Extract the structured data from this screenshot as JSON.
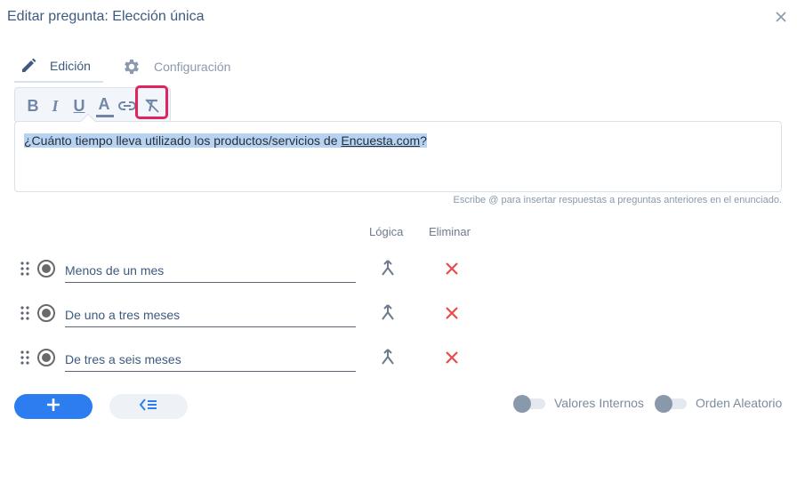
{
  "dialog": {
    "title": "Editar pregunta: Elección única",
    "close_icon": "close-icon"
  },
  "tabs": [
    {
      "label": "Edición",
      "icon": "pencil-icon",
      "active": true
    },
    {
      "label": "Configuración",
      "icon": "gear-icon",
      "active": false
    }
  ],
  "toolbar": {
    "bold": "B",
    "italic": "I",
    "underline": "U",
    "color": "A",
    "link_icon": "link-icon",
    "clear_format_icon": "clear-format-icon",
    "highlight_color": "#e0245e"
  },
  "editor": {
    "text_before": "¿Cuánto tiempo lleva utilizado los productos/servicios de ",
    "link_text": "Encuesta.com",
    "text_after": "?",
    "hint": "Escribe @ para insertar respuestas a preguntas anteriores en el enunciado."
  },
  "columns": {
    "logic": "Lógica",
    "delete": "Eliminar"
  },
  "answers": [
    {
      "value": "Menos de un mes"
    },
    {
      "value": "De uno a tres meses"
    },
    {
      "value": "De tres a seis meses"
    }
  ],
  "footer": {
    "add_icon": "plus-icon",
    "bulk_icon": "bulk-list-icon",
    "internal_values_label": "Valores Internos",
    "random_order_label": "Orden Aleatorio"
  },
  "colors": {
    "primary": "#2b7df0",
    "title": "#3d5a80",
    "delete": "#e84b4b",
    "selection": "#b7d3f2"
  }
}
